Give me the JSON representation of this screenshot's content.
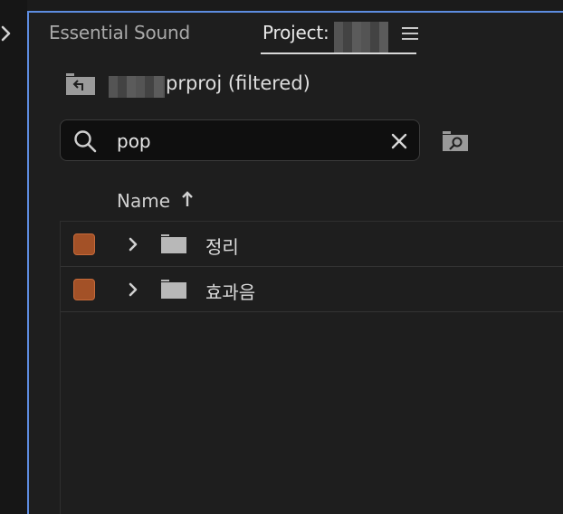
{
  "tabs": {
    "essential_sound": "Essential Sound",
    "project": "Project:"
  },
  "breadcrumb": {
    "path_suffix": "prproj (filtered)"
  },
  "search": {
    "value": "pop",
    "placeholder": ""
  },
  "columns": {
    "name": "Name",
    "sort": "ascending"
  },
  "items": [
    {
      "name": "정리",
      "type": "folder",
      "label_color": "#a35127"
    },
    {
      "name": "효과음",
      "type": "folder",
      "label_color": "#a35127"
    }
  ],
  "colors": {
    "focus_border": "#5d8ce0",
    "panel_bg": "#1e1e1e",
    "label_orange": "#a35127"
  },
  "icons": [
    "chevron-right-icon",
    "menu-icon",
    "up-folder-icon",
    "search-icon",
    "clear-icon",
    "find-icon",
    "sort-arrow-up-icon",
    "folder-icon"
  ]
}
